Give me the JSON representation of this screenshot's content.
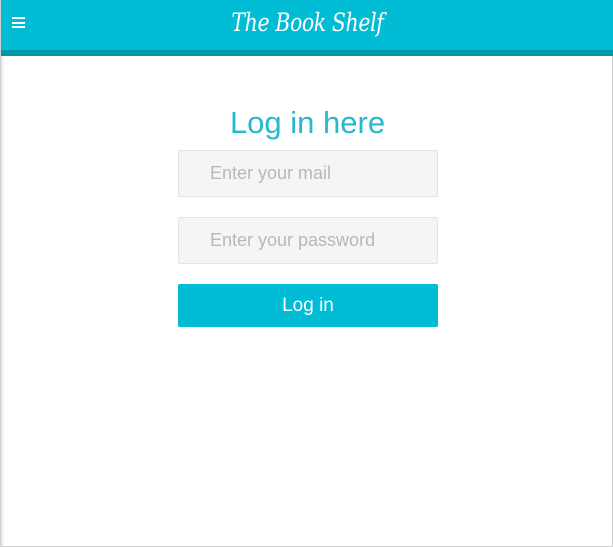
{
  "header": {
    "brand": "The Book Shelf",
    "menu_icon": "hamburger-menu-icon"
  },
  "login": {
    "title": "Log in here",
    "email_placeholder": "Enter your mail",
    "email_value": "",
    "password_placeholder": "Enter your password",
    "password_value": "",
    "button_label": "Log in"
  },
  "colors": {
    "accent": "#00bcd4",
    "accent_dark": "#0097a7",
    "title": "#26b8d2",
    "field_background": "#f5f5f5",
    "placeholder": "#b8b8b8"
  }
}
